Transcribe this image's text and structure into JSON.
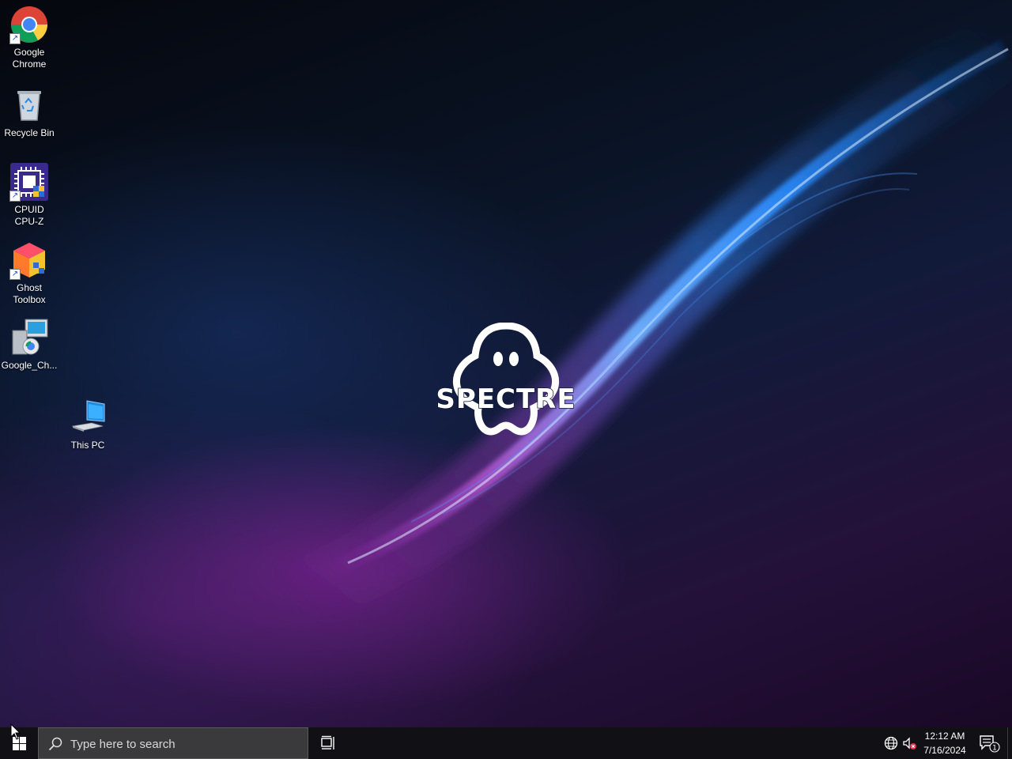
{
  "desktop": {
    "wallpaper_brand": "SPECTRE",
    "icons": [
      {
        "label_line1": "Google",
        "label_line2": "Chrome",
        "icon": "chrome-icon"
      },
      {
        "label_line1": "Recycle Bin",
        "label_line2": "",
        "icon": "recycle-bin-icon"
      },
      {
        "label_line1": "CPUID",
        "label_line2": "CPU-Z",
        "icon": "cpu-z-icon"
      },
      {
        "label_line1": "Ghost",
        "label_line2": "Toolbox",
        "icon": "ghost-toolbox-icon"
      },
      {
        "label_line1": "Google_Ch...",
        "label_line2": "",
        "icon": "installer-icon"
      },
      {
        "label_line1": "This PC",
        "label_line2": "",
        "icon": "this-pc-icon"
      }
    ]
  },
  "taskbar": {
    "search_placeholder": "Type here to search",
    "clock_time": "12:12 AM",
    "clock_date": "7/16/2024",
    "notification_count": "1",
    "colors": {
      "taskbar_bg": "#101015",
      "search_bg": "#3a3a3c"
    }
  }
}
